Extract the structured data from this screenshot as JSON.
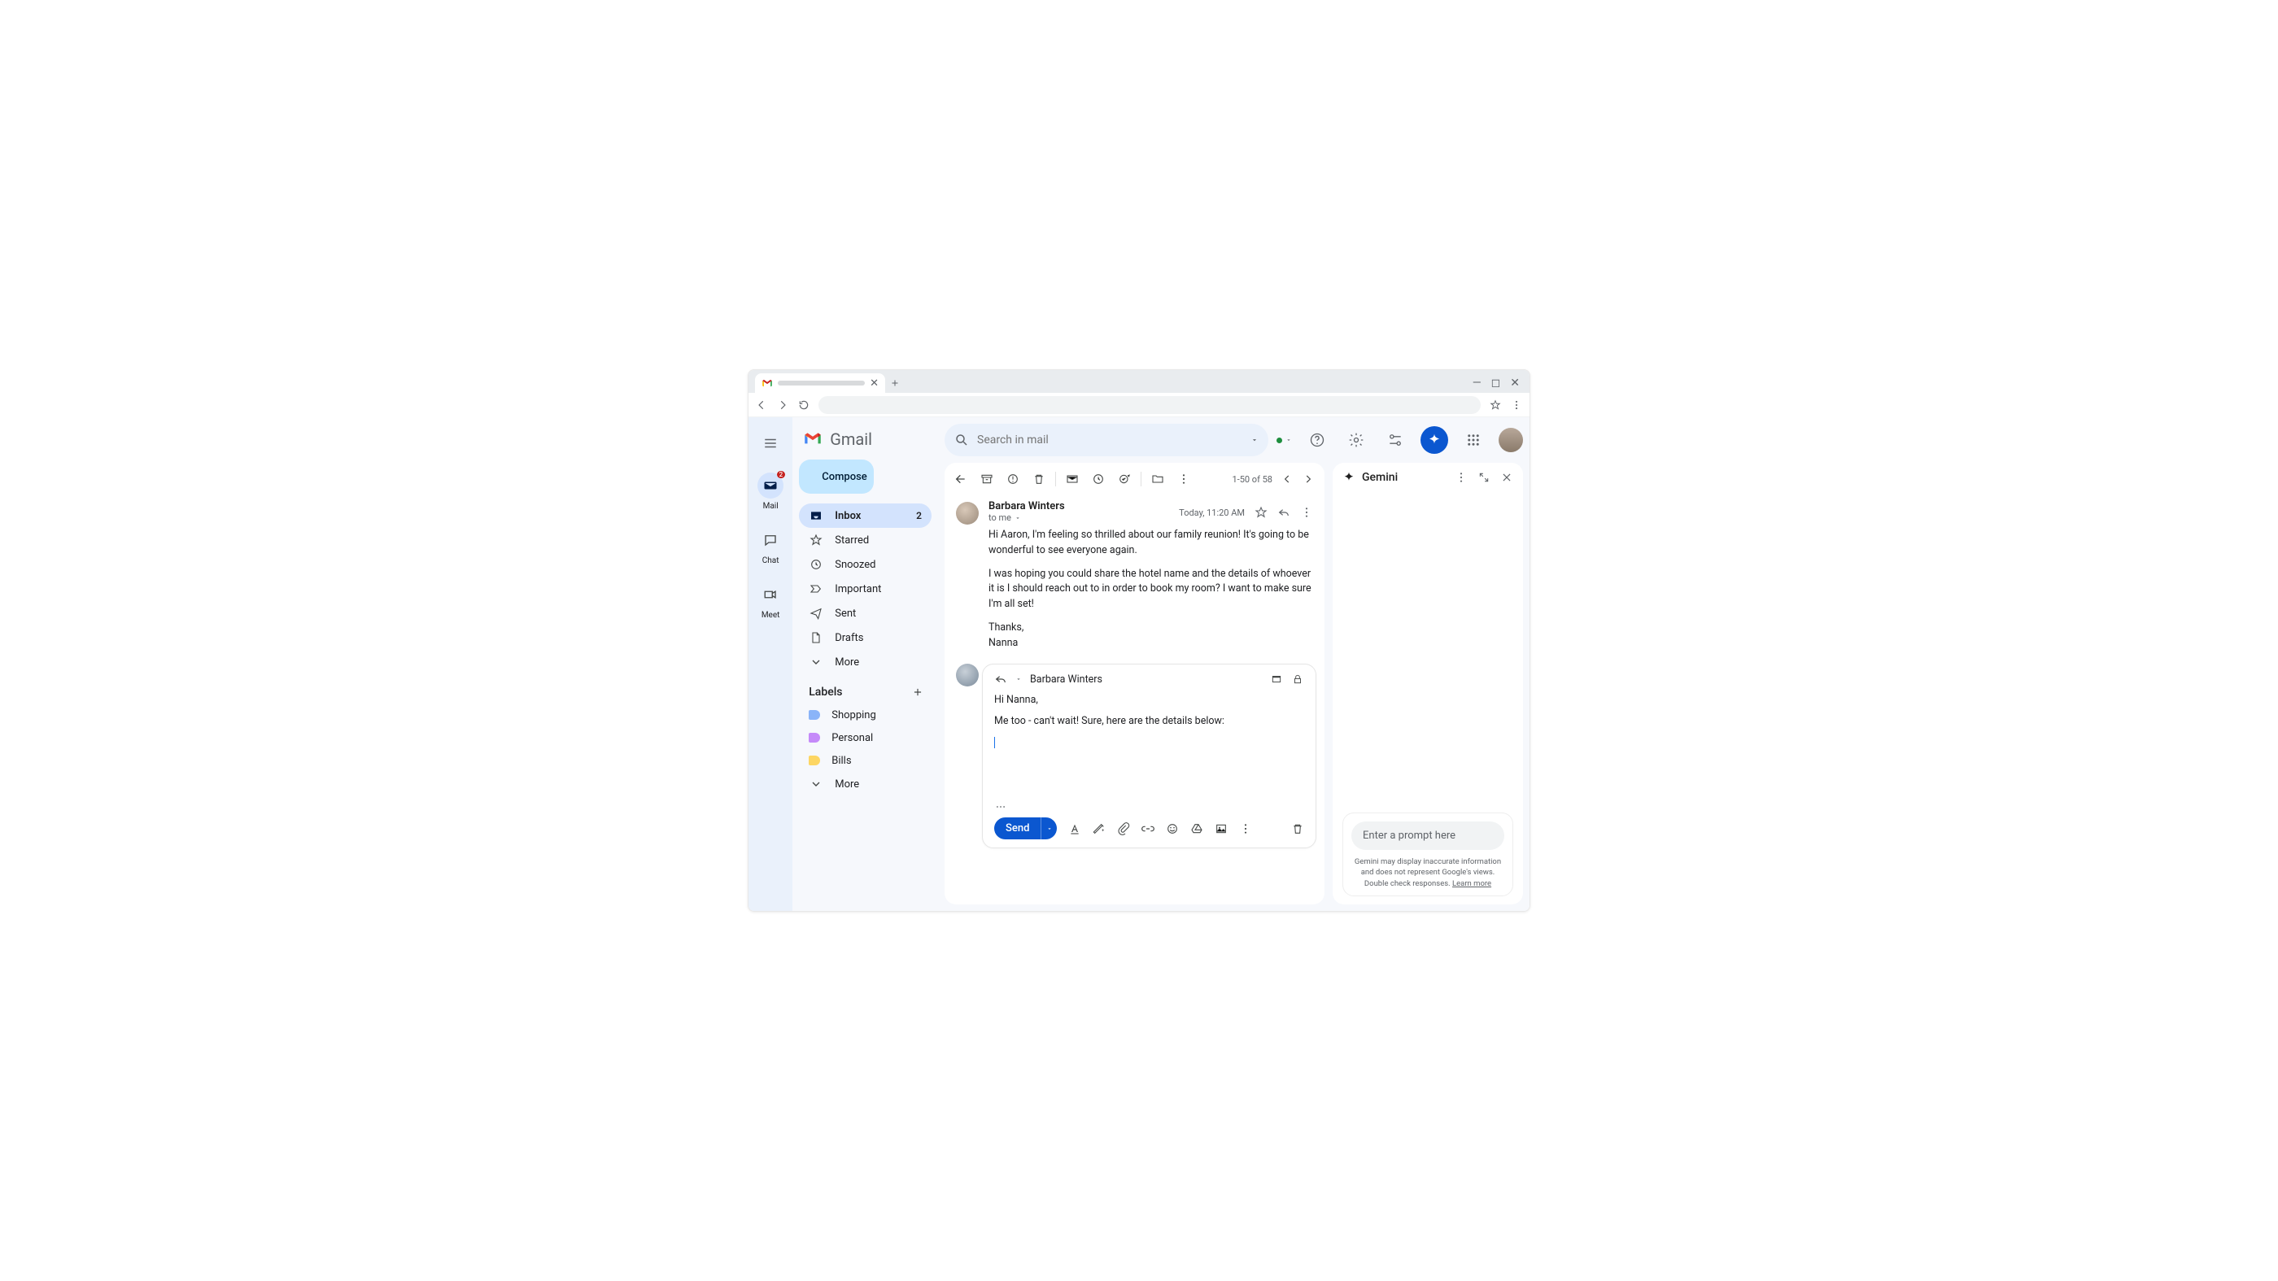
{
  "brand": "Gmail",
  "search": {
    "placeholder": "Search in mail"
  },
  "rail": {
    "badge": "2",
    "items": [
      {
        "label": "Mail"
      },
      {
        "label": "Chat"
      },
      {
        "label": "Meet"
      }
    ]
  },
  "compose_label": "Compose",
  "nav": {
    "inbox": {
      "label": "Inbox",
      "count": "2"
    },
    "starred": "Starred",
    "snoozed": "Snoozed",
    "important": "Important",
    "sent": "Sent",
    "drafts": "Drafts",
    "more": "More"
  },
  "labels": {
    "header": "Labels",
    "items": [
      {
        "label": "Shopping",
        "color": "#8ab4f8"
      },
      {
        "label": "Personal",
        "color": "#c58af9"
      },
      {
        "label": "Bills",
        "color": "#fdd663"
      }
    ],
    "more": "More"
  },
  "pagination": "1-50 of 58",
  "message": {
    "sender": "Barbara Winters",
    "recipient": "to me",
    "time": "Today, 11:20 AM",
    "p1": "Hi Aaron,  I'm feeling so thrilled about our family reunion! It's going to be wonderful to see everyone again.",
    "p2": "I was hoping you could share the hotel name and the details of whoever it is I should reach out to in order to book my room? I want to make sure I'm all set!",
    "sign1": "Thanks,",
    "sign2": "Nanna"
  },
  "reply": {
    "to": "Barbara Winters",
    "line1": "Hi Nanna,",
    "line2": "Me too - can't wait! Sure, here are the details below:",
    "send_label": "Send"
  },
  "gemini": {
    "title": "Gemini",
    "prompt_placeholder": "Enter a prompt here",
    "disclaimer": "Gemini may display inaccurate information and does not represent Google's views. Double check responses. ",
    "learn": "Learn more"
  }
}
